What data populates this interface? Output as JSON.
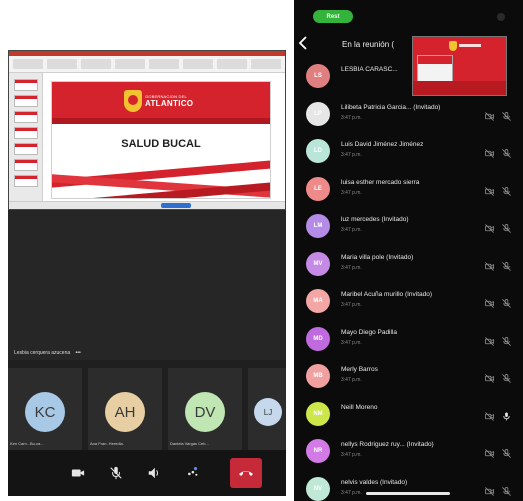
{
  "tablet": {
    "slide": {
      "logo_sub": "GOBERNACION DEL",
      "logo_main": "ATLANTICO",
      "title": "SALUD BUCAL"
    },
    "active_speaker": {
      "name": "Lesbia cerquera azucena",
      "more": "•••"
    },
    "tiles": [
      {
        "initials": "KC",
        "name": "Ken Cam...Bu.ca...",
        "color": "#a8c9e6"
      },
      {
        "initials": "AH",
        "name": "Ana Fran. Heredia.",
        "color": "#e8cfa3"
      },
      {
        "initials": "DV",
        "name": "Daniela Vargas Ceb...",
        "color": "#bfe6b3"
      },
      {
        "initials": "LJ",
        "name": "",
        "color": "#c5d8ec"
      }
    ],
    "controls": [
      "camera-icon",
      "microphone-icon",
      "speaker-icon",
      "participants-icon",
      "hangup-icon"
    ],
    "colors": {
      "brand_red": "#d4232c",
      "brand_gold": "#f2c230",
      "hangup": "#c62a38"
    }
  },
  "phone": {
    "pill": "Rest",
    "header_title": "En la reunión (",
    "participants": [
      {
        "initials": "LS",
        "name": "LESBIA CARASC...",
        "time": "",
        "color": "#e07f7f",
        "cam": false,
        "mic": false
      },
      {
        "initials": "LP",
        "name": "Lilibeta Patricia Garcia... (Invitado)",
        "time": "3:47 p.m.",
        "color": "#e6e6e6",
        "cam": true,
        "mic": true
      },
      {
        "initials": "LD",
        "name": "Luis David Jiménez Jiménez",
        "time": "3:47 p.m.",
        "color": "#b9e6d9",
        "cam": true,
        "mic": true
      },
      {
        "initials": "LE",
        "name": "luisa esther mercado sierra",
        "time": "3:47 p.m.",
        "color": "#ef8a8a",
        "cam": true,
        "mic": true
      },
      {
        "initials": "LM",
        "name": "luz mercedes  (Invitado)",
        "time": "3:47 p.m.",
        "color": "#b48be6",
        "cam": true,
        "mic": true
      },
      {
        "initials": "MV",
        "name": "Maria villa pole  (Invitado)",
        "time": "3:47 p.m.",
        "color": "#c58ae6",
        "cam": true,
        "mic": true
      },
      {
        "initials": "MA",
        "name": "Maribel Acuña murillo (Invitado)",
        "time": "3:47 p.m.",
        "color": "#f2a6a6",
        "cam": true,
        "mic": true
      },
      {
        "initials": "MD",
        "name": "Mayo Diego Padilla",
        "time": "3:47 p.m.",
        "color": "#c06ae0",
        "cam": true,
        "mic": true
      },
      {
        "initials": "MB",
        "name": "Merly Barros",
        "time": "3:47 p.m.",
        "color": "#f0a0a0",
        "cam": true,
        "mic": true
      },
      {
        "initials": "NM",
        "name": "Neill Moreno",
        "time": "",
        "color": "#cde64a",
        "cam": true,
        "mic": true
      },
      {
        "initials": "NR",
        "name": "nellys Rodriguez ruy... (Invitado)",
        "time": "3:47 p.m.",
        "color": "#d27ae6",
        "cam": true,
        "mic": true
      },
      {
        "initials": "NV",
        "name": "nelvis valdes  (Invitado)",
        "time": "3:47 p.m.",
        "color": "#bfe8d6",
        "cam": true,
        "mic": true
      }
    ]
  }
}
